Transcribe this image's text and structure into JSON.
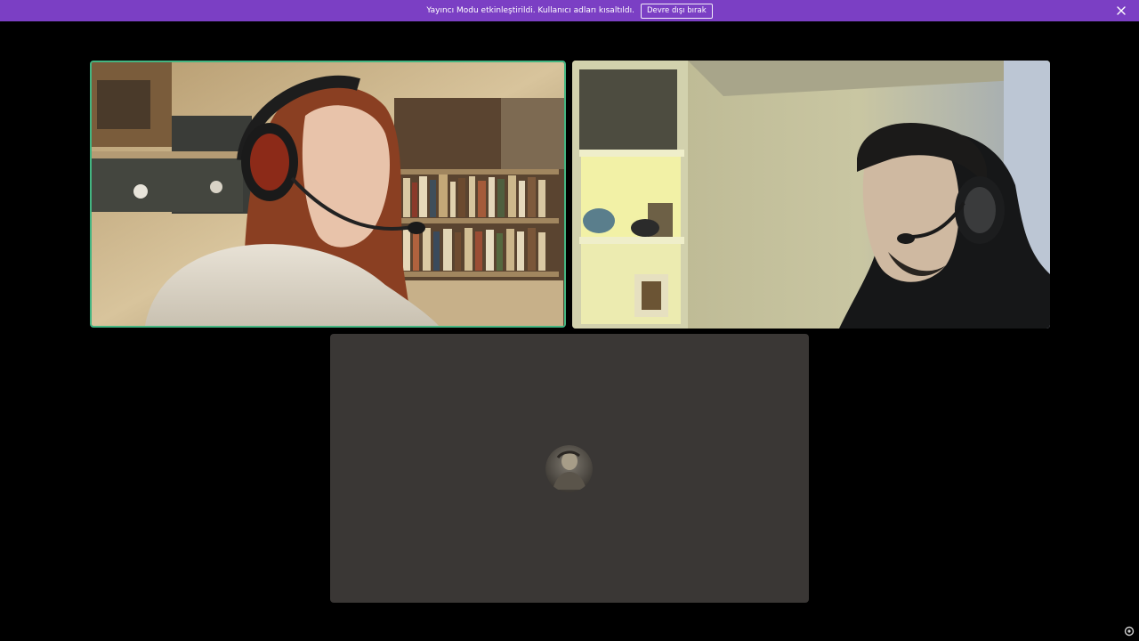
{
  "banner": {
    "message": "Yayıncı Modu etkinleştirildi. Kullanıcı adları kısaltıldı.",
    "disable_label": "Devre dışı bırak",
    "color": "#7b3fc4"
  },
  "call": {
    "participants": [
      {
        "tile": "video",
        "speaking": true,
        "icon": "video-stream"
      },
      {
        "tile": "video",
        "speaking": false,
        "icon": "video-stream"
      },
      {
        "tile": "avatar",
        "speaking": false,
        "icon": "user-avatar"
      }
    ],
    "speaking_color": "#43b581",
    "empty_tile_color": "#3a3735"
  },
  "icons": {
    "close": "close-icon",
    "corner": "settings-icon"
  }
}
